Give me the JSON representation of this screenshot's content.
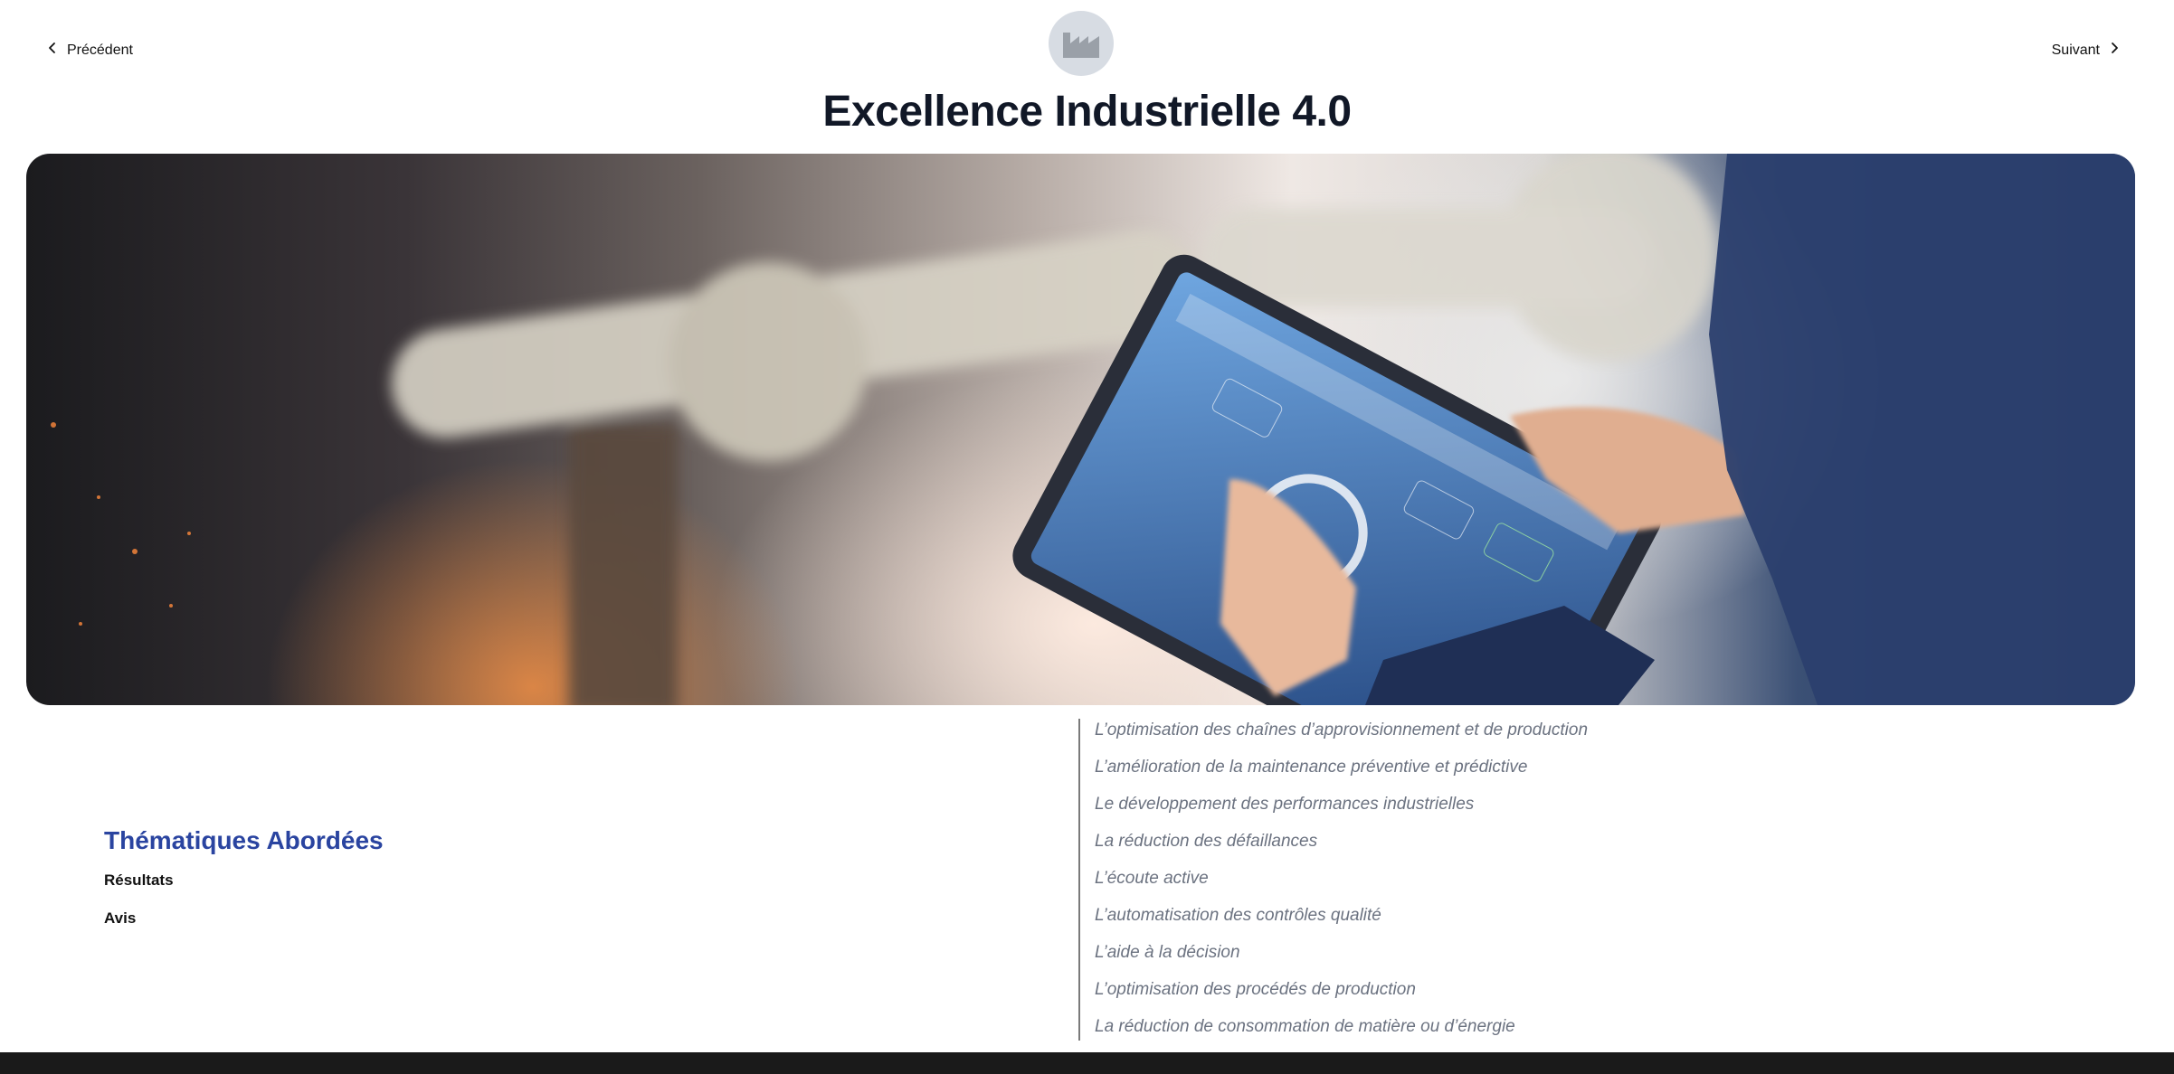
{
  "nav": {
    "prev_label": "Précédent",
    "next_label": "Suivant"
  },
  "logo": {
    "icon": "factory-icon"
  },
  "page": {
    "title": "Excellence Industrielle 4.0"
  },
  "hero": {
    "image": "technician-tablet-robot-arm"
  },
  "sections": {
    "title": "Thématiques Abordées",
    "links": [
      "Résultats",
      "Avis"
    ]
  },
  "topics": [
    "L’optimisation des chaînes d’approvisionnement et de production",
    "L’amélioration de la maintenance préventive et prédictive",
    "Le développement des performances industrielles",
    "La réduction des défaillances",
    "L’écoute active",
    "L’automatisation des contrôles qualité",
    "L’aide à la décision",
    "L’optimisation des procédés de production",
    "La réduction de consommation de matière ou d’énergie"
  ],
  "colors": {
    "accent": "#2a44a0",
    "topic_text": "#6b7280",
    "footer": "#1a1a1a"
  }
}
